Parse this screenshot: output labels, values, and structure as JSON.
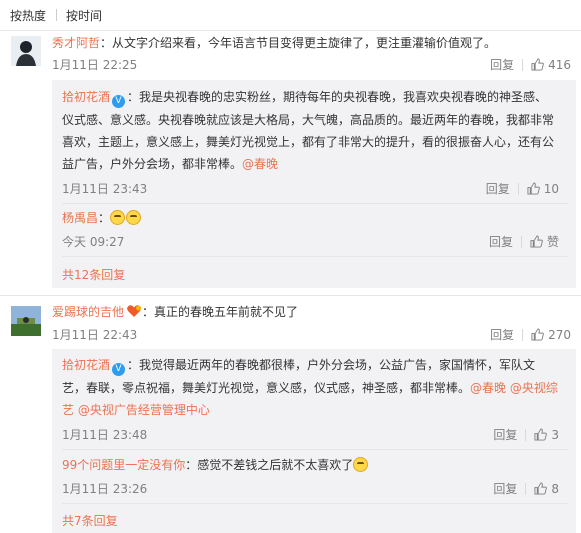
{
  "sort": {
    "hot": "按热度",
    "time": "按时间"
  },
  "comments": [
    {
      "user": "秀才阿哲",
      "text": "：从文字介绍来看，今年语言节目变得更主旋律了，更注重灌输价值观了。",
      "time": "1月11日 22:25",
      "reply_label": "回复",
      "likes": "416",
      "replies": [
        {
          "user": "拾初花酒",
          "badge": "V",
          "lines": [
            "：我是央视春晚的忠实粉丝，期待每年的央视春晚，我喜欢央视春晚的神圣感、",
            "仪式感、意义感。央视春晚就应该是大格局，大气魄，高品质的。最近两年的春晚，我都非常",
            "喜欢，主题上，意义感上，舞美灯光视觉上，都有了非常大的提升，看的很振奋人心，还有公",
            "益广告，户外分会场，都非常棒。"
          ],
          "link": "@春晚",
          "time": "1月11日 23:43",
          "reply_label": "回复",
          "likes": "10"
        },
        {
          "user": "杨禹昌",
          "text": "：",
          "time": "今天 09:27",
          "reply_label": "回复",
          "likes": "赞"
        }
      ],
      "more": "共12条回复"
    },
    {
      "user": "爱踢球的吉他",
      "text": "：真正的春晚五年前就不见了",
      "time": "1月11日 22:43",
      "reply_label": "回复",
      "likes": "270",
      "replies": [
        {
          "user": "拾初花酒",
          "badge": "V",
          "lines": [
            "：我觉得最近两年的春晚都很棒，户外分会场，公益广告，家国情怀，军队文",
            "艺，春联，零点祝福，舞美灯光视觉，意义感，仪式感，神圣感，都非常棒。"
          ],
          "line2_links": "@春晚 @央视综",
          "line3": "艺 @央视广告经营管理中心",
          "time": "1月11日 23:48",
          "reply_label": "回复",
          "likes": "3"
        },
        {
          "user": "99个问题里一定没有你",
          "text": "：感觉不差钱之后就不太喜欢了",
          "time": "1月11日 23:26",
          "reply_label": "回复",
          "likes": "8"
        }
      ],
      "more": "共7条回复"
    }
  ]
}
